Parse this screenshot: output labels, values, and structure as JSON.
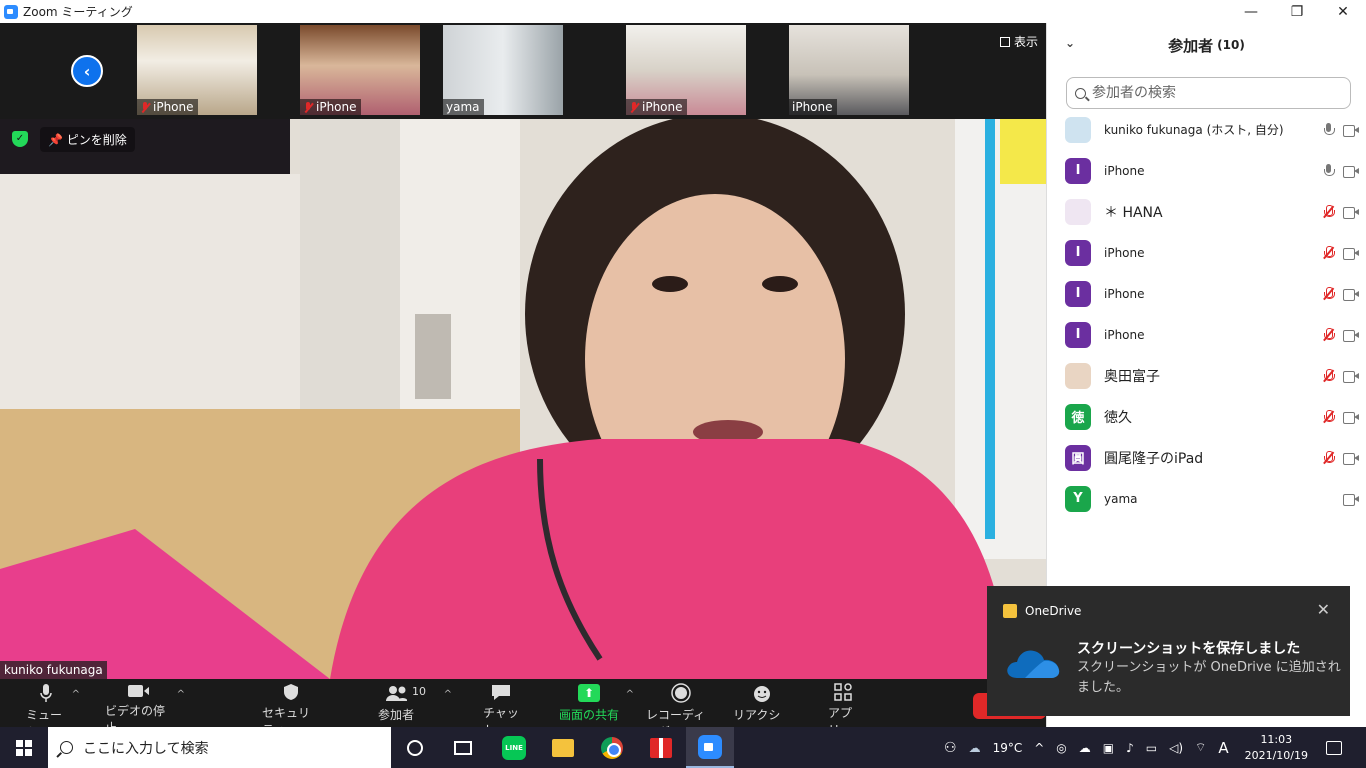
{
  "window": {
    "title": "Zoom ミーティング",
    "controls": [
      "—",
      "❐",
      "✕"
    ]
  },
  "thumbnails": [
    {
      "name": "iPhone",
      "muted": true
    },
    {
      "name": "iPhone",
      "muted": true
    },
    {
      "name": "yama",
      "muted": false
    },
    {
      "name": "iPhone",
      "muted": true
    },
    {
      "name": "iPhone",
      "muted": false
    }
  ],
  "view_button": "表示",
  "main_video": {
    "unpin_label": "ピンを削除",
    "speaker_name": "kuniko fukunaga"
  },
  "toolbar": {
    "mute": "ミュート",
    "video": "ビデオの停止",
    "security": "セキュリティ",
    "participants": "参加者",
    "participants_count": "10",
    "chat": "チャット",
    "share": "画面の共有",
    "record": "レコーディング",
    "reactions": "リアクション",
    "apps": "アプリ"
  },
  "panel": {
    "title": "参加者",
    "count": "(10)",
    "search_placeholder": "参加者の検索",
    "participants": [
      {
        "name": "kuniko fukunaga (ホスト, 自分)",
        "avatar": "",
        "avatar_color": "#cfe3f0",
        "mic": "on"
      },
      {
        "name": "iPhone",
        "avatar": "I",
        "avatar_color": "#6b2fa0",
        "mic": "on"
      },
      {
        "name": "＊ HANA",
        "avatar": "",
        "avatar_color": "#efe6f2",
        "mic": "muted"
      },
      {
        "name": "iPhone",
        "avatar": "I",
        "avatar_color": "#6b2fa0",
        "mic": "muted"
      },
      {
        "name": "iPhone",
        "avatar": "I",
        "avatar_color": "#6b2fa0",
        "mic": "muted"
      },
      {
        "name": "iPhone",
        "avatar": "I",
        "avatar_color": "#6b2fa0",
        "mic": "muted"
      },
      {
        "name": "奥田富子",
        "avatar": "",
        "avatar_color": "#e9d5c3",
        "mic": "muted"
      },
      {
        "name": "徳久",
        "avatar": "徳",
        "avatar_color": "#1aa64b",
        "mic": "muted"
      },
      {
        "name": "圓尾隆子のiPad",
        "avatar": "圓",
        "avatar_color": "#6b2fa0",
        "mic": "muted"
      },
      {
        "name": "yama",
        "avatar": "Y",
        "avatar_color": "#1aa64b",
        "mic": "none"
      }
    ]
  },
  "toast": {
    "app": "OneDrive",
    "title": "スクリーンショットを保存しました",
    "body": "スクリーンショットが OneDrive に追加されました。"
  },
  "taskbar": {
    "search_placeholder": "ここに入力して検索",
    "line_label": "LINE",
    "weather": "19°C",
    "ime": "A",
    "time": "11:03",
    "date": "2021/10/19"
  }
}
